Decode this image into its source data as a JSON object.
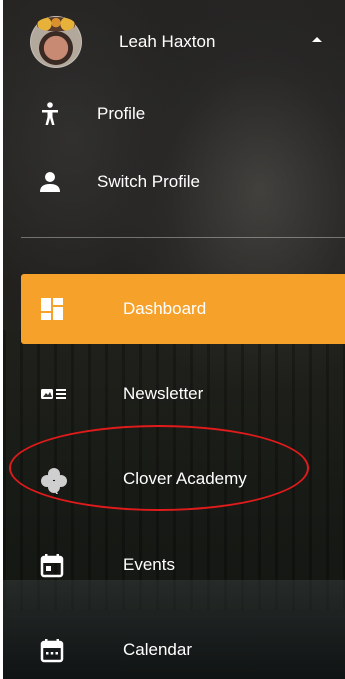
{
  "user": {
    "name": "Leah Haxton",
    "avatar_icon": "user-photo",
    "toggle_icon": "caret-up-icon"
  },
  "account_menu": [
    {
      "label": "Profile",
      "icon": "person-walking-icon"
    },
    {
      "label": "Switch Profile",
      "icon": "person-icon"
    }
  ],
  "nav": {
    "items": [
      {
        "label": "Dashboard",
        "icon": "dashboard-icon",
        "active": true
      },
      {
        "label": "Newsletter",
        "icon": "newsletter-icon",
        "active": false
      },
      {
        "label": "Clover Academy",
        "icon": "clover-icon",
        "active": false
      },
      {
        "label": "Events",
        "icon": "calendar-day-icon",
        "active": false
      },
      {
        "label": "Calendar",
        "icon": "calendar-icon",
        "active": false
      }
    ]
  },
  "colors": {
    "active_background": "#f6a12a",
    "text": "#ffffff",
    "highlight_ring": "#e01b1b"
  }
}
